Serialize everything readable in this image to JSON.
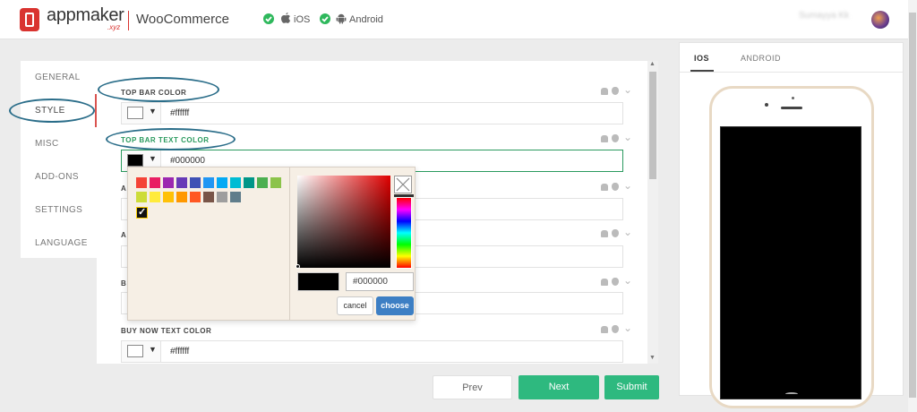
{
  "header": {
    "brand": "appmaker",
    "brand_sub": ".xyz",
    "product": "WooCommerce",
    "platforms": [
      "iOS",
      "Android"
    ],
    "user_name": "Sumayya Kk"
  },
  "sidebar": {
    "tabs": [
      "GENERAL",
      "STYLE",
      "MISC",
      "ADD-ONS",
      "SETTINGS",
      "LANGUAGE"
    ],
    "active": "STYLE"
  },
  "form": {
    "fields": [
      {
        "label": "TOP BAR COLOR",
        "value": "#ffffff",
        "swatch": "#ffffff"
      },
      {
        "label": "TOP BAR TEXT COLOR",
        "value": "#000000",
        "swatch": "#000000"
      },
      {
        "label": "A",
        "value": "",
        "swatch": "#ffffff"
      },
      {
        "label": "A",
        "value": "",
        "swatch": "#ffffff"
      },
      {
        "label": "B",
        "value": "",
        "swatch": "#ffffff"
      },
      {
        "label": "BUY NOW TEXT COLOR",
        "value": "#ffffff",
        "swatch": "#ffffff"
      }
    ]
  },
  "picker": {
    "palette": [
      "#f44336",
      "#e91e63",
      "#9c27b0",
      "#673ab7",
      "#3f51b5",
      "#2196f3",
      "#03a9f4",
      "#00bcd4",
      "#009688",
      "#4caf50",
      "#8bc34a",
      "#cddc39",
      "#ffeb3b",
      "#ffc107",
      "#ff9800",
      "#ff5722",
      "#795548",
      "#9e9e9e",
      "#607d8b"
    ],
    "selected": "#000000",
    "hex_value": "#000000",
    "cancel_label": "cancel",
    "choose_label": "choose"
  },
  "nav": {
    "prev_label": "Prev",
    "next_label": "Next",
    "submit_label": "Submit"
  },
  "preview": {
    "tabs": [
      "IOS",
      "ANDROID"
    ],
    "active": "IOS"
  }
}
